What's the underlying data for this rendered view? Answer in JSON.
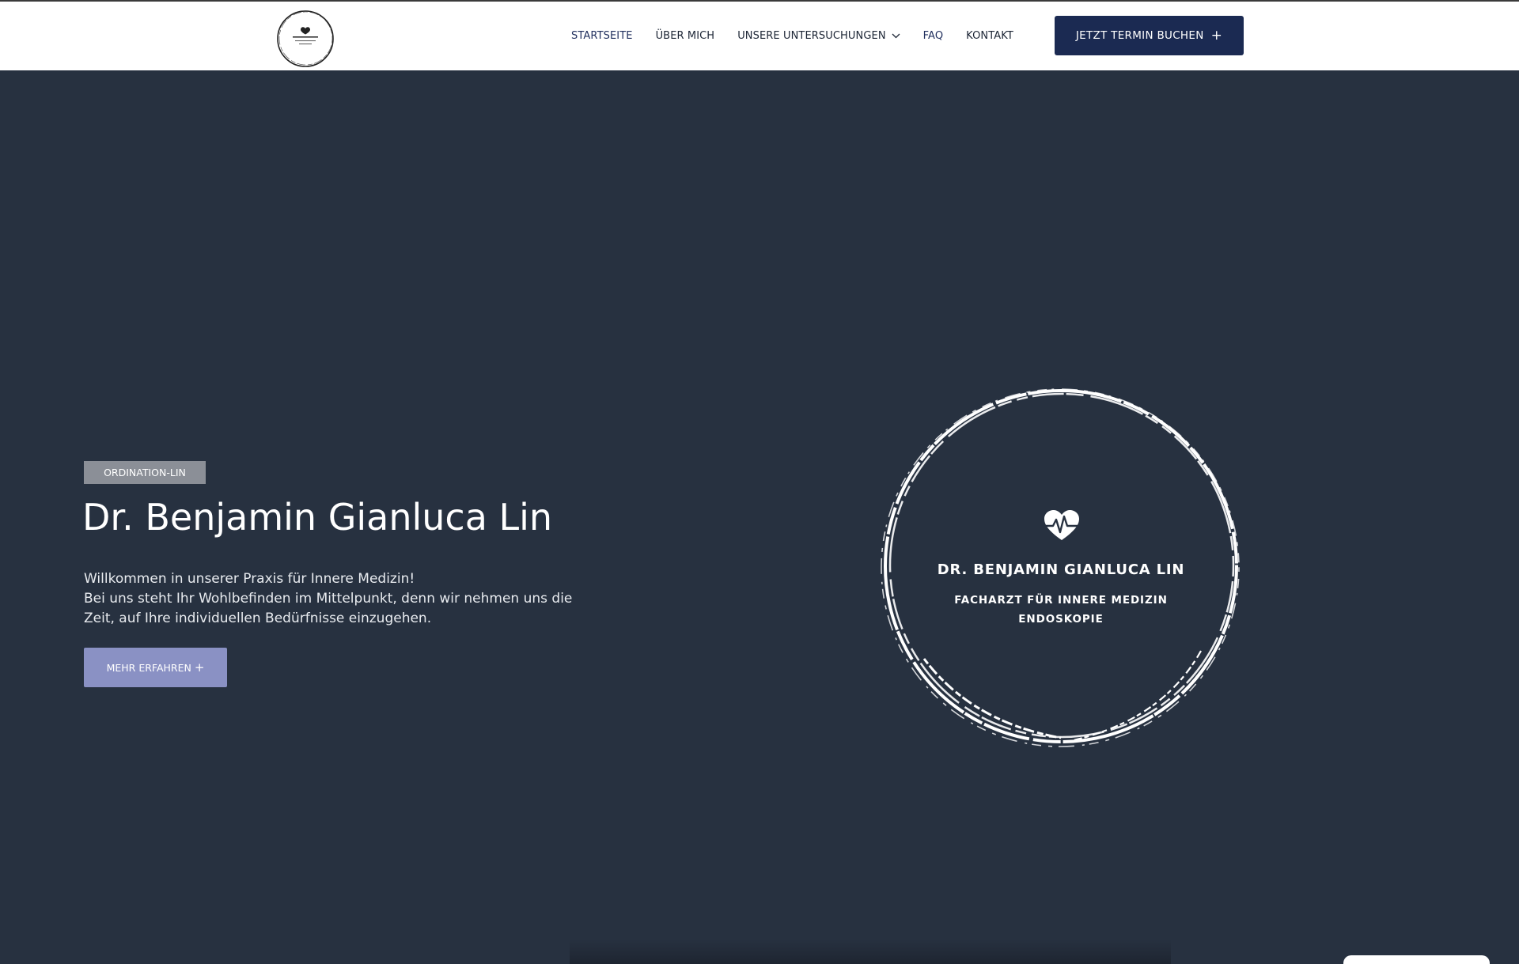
{
  "header": {
    "logo_text": "DR. BENJAMIN GIANLUCA LIN",
    "nav": [
      {
        "label": "STARTSEITE",
        "active": true
      },
      {
        "label": "ÜBER MICH"
      },
      {
        "label": "UNSERE UNTERSUCHUNGEN",
        "has_dropdown": true
      },
      {
        "label": "FAQ"
      },
      {
        "label": "KONTAKT"
      }
    ],
    "cta_label": "JETZT TERMIN BUCHEN",
    "cta_icon": "plus-icon"
  },
  "hero": {
    "tag": "ORDINATION-LIN",
    "title": "Dr. Benjamin Gianluca Lin",
    "text_lines": [
      "Willkommen in unserer Praxis für Innere Medizin!",
      "Bei uns steht Ihr Wohlbefinden im Mittelpunkt, denn wir nehmen uns die",
      "Zeit, auf Ihre individuellen Bedürfnisse einzugehen."
    ],
    "button_label": "MEHR ERFAHREN",
    "button_icon": "plus-icon"
  },
  "emblem": {
    "icon": "heart-pulse-icon",
    "name": "DR. BENJAMIN GIANLUCA LIN",
    "subtitle_lines": [
      "FACHARZT FÜR INNERE MEDIZIN",
      "ENDOSKOPIE"
    ]
  },
  "colors": {
    "background": "#273140",
    "header_bg": "#ffffff",
    "cta_bg": "#1b2a52",
    "tag_bg": "#8b8f97",
    "more_button_bg": "#8a91c4",
    "nav_active": "#1e2d5c"
  }
}
